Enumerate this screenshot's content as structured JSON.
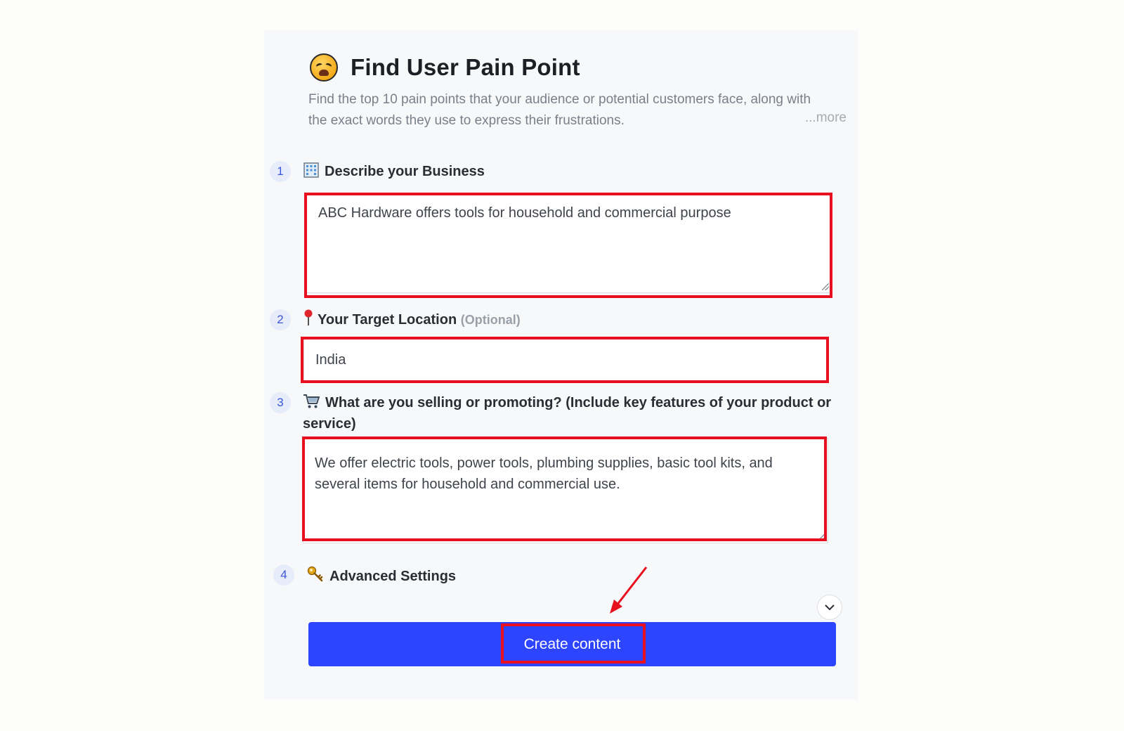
{
  "header": {
    "title": "Find User Pain Point",
    "description": "Find the top 10 pain points that your audience or potential customers face, along with the exact words they use to express their frustrations.",
    "more_label": "...more"
  },
  "steps": [
    {
      "number": "1",
      "label": "Describe your Business",
      "icon": "office-building-icon",
      "value": "ABC Hardware offers tools for household and commercial purpose"
    },
    {
      "number": "2",
      "label": "Your Target Location",
      "optional_label": "(Optional)",
      "icon": "pushpin-icon",
      "value": "India"
    },
    {
      "number": "3",
      "label": "What are you selling or promoting? (Include key features of your product or service)",
      "icon": "shopping-cart-icon",
      "value": "We offer electric tools, power tools, plumbing supplies, basic tool kits, and several items for household and commercial use."
    },
    {
      "number": "4",
      "label": "Advanced Settings",
      "icon": "key-icon"
    }
  ],
  "actions": {
    "create_label": "Create content"
  },
  "colors": {
    "accent": "#2e45ff",
    "highlight": "#e80f1f",
    "step_badge_bg": "#e7ecfb",
    "step_badge_text": "#3c55d9"
  }
}
